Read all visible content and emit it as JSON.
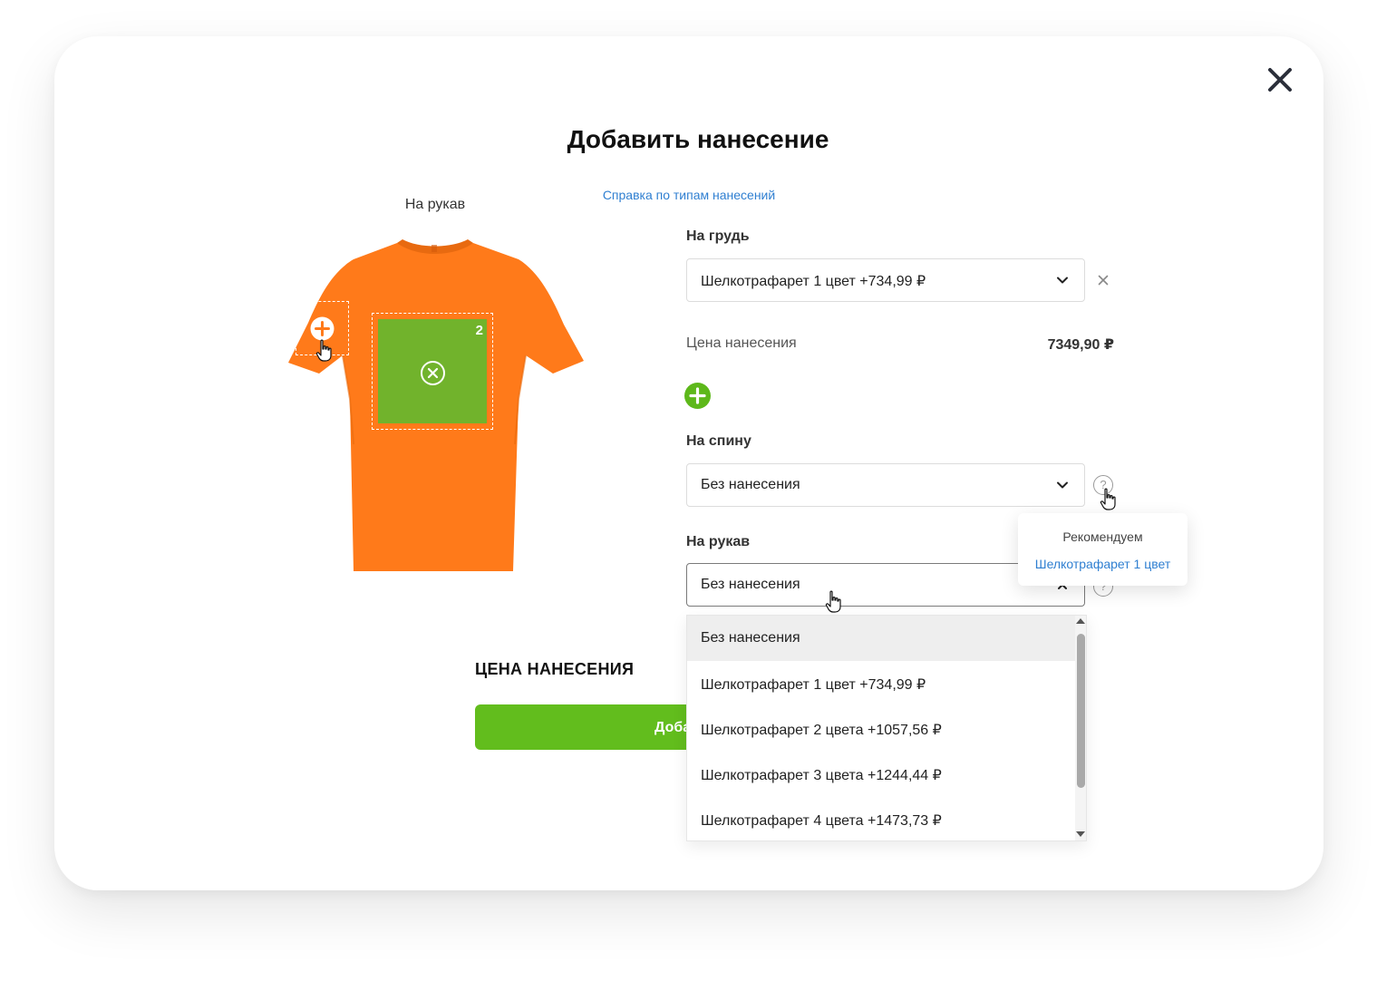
{
  "modal": {
    "title": "Добавить нанесение",
    "help_link": "Справка по типам нанесений"
  },
  "preview": {
    "caption": "На рукав",
    "tshirt_color": "#ff7a1a",
    "zone_fill_color": "#71b32c",
    "front_zone_number": "2"
  },
  "chest": {
    "label": "На грудь",
    "selected": "Шелкотрафарет 1 цвет +734,99 ₽",
    "price_label": "Цена нанесения",
    "price_value": "7349,90 ₽"
  },
  "back": {
    "label": "На спину",
    "selected": "Без нанесения",
    "help_icon": "?"
  },
  "tooltip": {
    "title": "Рекомендуем",
    "link": "Шелкотрафарет 1 цвет"
  },
  "sleeve": {
    "label": "На рукав",
    "selected": "Без нанесения",
    "help_icon": "?"
  },
  "dropdown": {
    "options": [
      "Без нанесения",
      "Шелкотрафарет 1 цвет +734,99 ₽",
      "Шелкотрафарет 2 цвета +1057,56 ₽",
      "Шелкотрафарет 3 цвета +1244,44 ₽",
      "Шелкотрафарет 4 цвета +1473,73 ₽"
    ],
    "selected_index": 0
  },
  "summary": {
    "total_label": "ЦЕНА НАНЕСЕНИЯ",
    "submit_label": "Добавить"
  },
  "colors": {
    "accent_green": "#62bd1d",
    "link_blue": "#2f7fd1"
  }
}
